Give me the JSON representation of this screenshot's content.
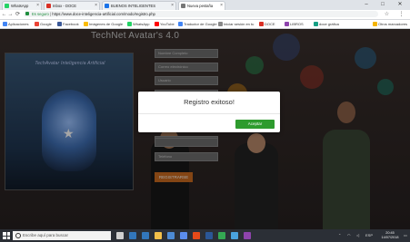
{
  "browser": {
    "tabs": [
      {
        "label": "WhatsApp",
        "color": "#25d366"
      },
      {
        "label": "Inbox - DOCE",
        "color": "#d93025"
      },
      {
        "label": "BUENOS INTELIGENTES",
        "color": "#1a73e8"
      },
      {
        "label": "Nueva pestaña",
        "color": "#777777"
      }
    ],
    "window_controls": [
      "–",
      "□",
      "✕"
    ],
    "nav": {
      "back": "←",
      "forward": "→",
      "reload": "⟳",
      "home": "⌂"
    },
    "url": {
      "secure_label": "Es seguro",
      "address": "https://www.doce-inteligencia-artificial.com/modo/registro.php"
    },
    "bookmarks": [
      {
        "label": "Aplicaciones",
        "color": "#4285f4"
      },
      {
        "label": "Google",
        "color": "#ea4335"
      },
      {
        "label": "Facebook",
        "color": "#3b5998"
      },
      {
        "label": "Imágenes de Google",
        "color": "#fbbc05"
      },
      {
        "label": "WhatsApp",
        "color": "#25d366"
      },
      {
        "label": "YouTube",
        "color": "#ff0000"
      },
      {
        "label": "Traductor de Google",
        "color": "#4285f4"
      },
      {
        "label": "Iniciar sesión en tu",
        "color": "#888888"
      },
      {
        "label": "DOCE",
        "color": "#d93025"
      },
      {
        "label": "LIBROS",
        "color": "#8e44ad"
      },
      {
        "label": "doce gráfica",
        "color": "#16a085"
      },
      {
        "label": "Otros marcadores",
        "color": "#f4b400"
      }
    ]
  },
  "page": {
    "site_title": "TechNet Avatar's 4.0",
    "logo_caption": "TechAvatar Inteligencia Artificial",
    "form_fields": [
      "Nombre Completo",
      "Correo electrónico",
      "Usuario",
      "",
      "",
      "",
      "Teléfono"
    ],
    "register_button": "REGISTRARSE"
  },
  "modal": {
    "message": "Registro exitoso!",
    "accept": "Aceptar"
  },
  "taskbar": {
    "search_placeholder": "Escribe aquí para buscar",
    "tray_lang": "ESP",
    "time": "20:45",
    "date": "14/07/2018",
    "icons": [
      {
        "name": "task-view",
        "color": "#d0d0d0"
      },
      {
        "name": "edge",
        "color": "#3277bc"
      },
      {
        "name": "file-explorer",
        "color": "#f3c04a"
      },
      {
        "name": "store",
        "color": "#4c8bd6"
      },
      {
        "name": "mail",
        "color": "#5b8def"
      },
      {
        "name": "office",
        "color": "#e64a19"
      },
      {
        "name": "word",
        "color": "#2b5797"
      },
      {
        "name": "chrome",
        "color": "#34a853"
      },
      {
        "name": "photos",
        "color": "#4aa3df"
      },
      {
        "name": "media",
        "color": "#8e44ad"
      }
    ]
  }
}
